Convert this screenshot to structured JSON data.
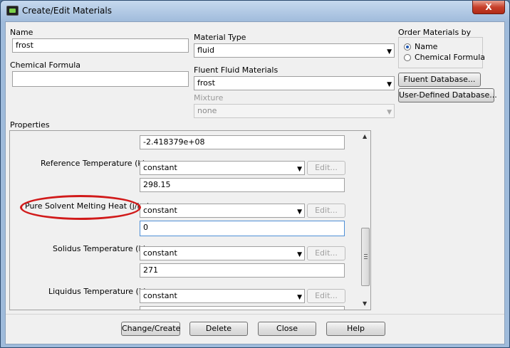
{
  "window": {
    "title": "Create/Edit Materials",
    "close_label": "X"
  },
  "name": {
    "label": "Name",
    "value": "frost"
  },
  "chemical_formula": {
    "label": "Chemical Formula",
    "value": ""
  },
  "material_type": {
    "label": "Material Type",
    "value": "fluid"
  },
  "fluent_fluid_materials": {
    "label": "Fluent Fluid Materials",
    "value": "frost"
  },
  "mixture": {
    "label": "Mixture",
    "value": "none"
  },
  "order": {
    "label": "Order Materials by",
    "options": [
      {
        "label": "Name",
        "selected": true
      },
      {
        "label": "Chemical Formula",
        "selected": false
      }
    ]
  },
  "buttons": {
    "fluent_database": "Fluent Database...",
    "user_defined_database": "User-Defined Database...",
    "change_create": "Change/Create",
    "delete": "Delete",
    "close": "Close",
    "help": "Help"
  },
  "properties": {
    "label": "Properties",
    "prev_value": "-2.418379e+08",
    "rows": [
      {
        "label": "Reference Temperature (k)",
        "method": "constant",
        "edit": "Edit...",
        "value": "298.15"
      },
      {
        "label": "Pure Solvent Melting Heat (j/kg)",
        "method": "constant",
        "edit": "Edit...",
        "value": "0"
      },
      {
        "label": "Solidus Temperature (k)",
        "method": "constant",
        "edit": "Edit...",
        "value": "271"
      },
      {
        "label": "Liquidus Temperature (k)",
        "method": "constant",
        "edit": "Edit...",
        "value": ""
      }
    ]
  },
  "colors": {
    "highlight_ellipse": "#d11a1a",
    "close_button": "#c7402b"
  }
}
